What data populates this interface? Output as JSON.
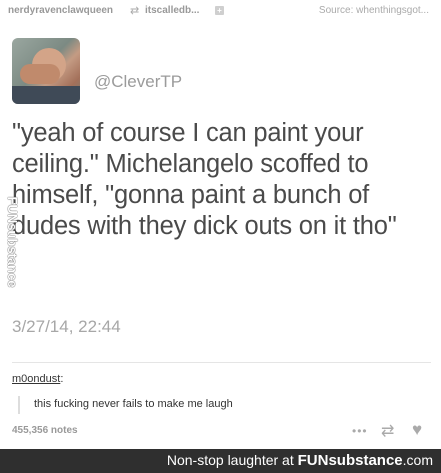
{
  "header": {
    "user": "nerdyravenclawqueen",
    "reblog_icon": "reblog-icon",
    "reblogged_from": "itscalledb...",
    "source": "Source: whenthingsgot..."
  },
  "tweet": {
    "handle": "@CleverTP",
    "text": "\"yeah of course I can paint your ceiling.\" Michelangelo scoffed to himself, \"gonna paint a bunch of dudes with they dick outs on it tho\"",
    "date": "3/27/14, 22:44"
  },
  "watermark": {
    "side_label": "FUNsubstance"
  },
  "comment": {
    "user": "m0ondust",
    "text": "this fucking never fails to make me laugh"
  },
  "post_footer": {
    "notes": "455,356 notes"
  },
  "bottom_bar": {
    "caption_prefix": "Non-stop laughter at ",
    "brand": "FUNsubstance",
    "domain": ".com"
  }
}
